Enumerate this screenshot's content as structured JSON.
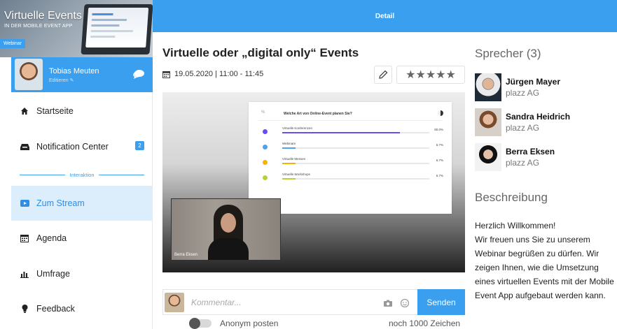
{
  "sidebar": {
    "banner": {
      "title": "Virtuelle Events",
      "subtitle": "IN DER MOBILE EVENT APP",
      "tag": "Webinar"
    },
    "profile": {
      "name": "Tobias Meuten",
      "edit_label": "Editieren"
    },
    "items": [
      {
        "label": "Startseite",
        "icon": "home-icon"
      },
      {
        "label": "Notification Center",
        "icon": "inbox-icon",
        "badge": "2"
      },
      {
        "label": "Zum Stream",
        "icon": "play-icon",
        "active": true
      },
      {
        "label": "Agenda",
        "icon": "calendar-icon"
      },
      {
        "label": "Umfrage",
        "icon": "bar-chart-icon"
      },
      {
        "label": "Feedback",
        "icon": "lightbulb-icon"
      }
    ],
    "section_label": "Interaktion"
  },
  "header": {
    "title": "Detail"
  },
  "event": {
    "title": "Virtuelle oder „digital only“ Events",
    "datetime": "19.05.2020 | 11:00 - 11:45",
    "rating_stars": "★★★★★"
  },
  "stream": {
    "slide": {
      "question": "Welche Art von Online-Event planen Sie?",
      "options": [
        {
          "label": "Virtuelle Konferenzen",
          "percent": "80.0%",
          "value": 0.8,
          "color": "#6a4cf0"
        },
        {
          "label": "Webinare",
          "percent": "6.7%",
          "value": 0.067,
          "color": "#4aa3f0"
        },
        {
          "label": "Virtuelle Messen",
          "percent": "6.7%",
          "value": 0.067,
          "color": "#f5b400"
        },
        {
          "label": "Virtuelle Workshops",
          "percent": "6.7%",
          "value": 0.067,
          "color": "#b5d334"
        }
      ]
    },
    "camera_label": "Berra Eksen"
  },
  "comment": {
    "placeholder": "Kommentar...",
    "send_label": "Senden",
    "anon_label": "Anonym posten",
    "char_count": "noch 1000 Zeichen"
  },
  "speakers": {
    "heading": "Sprecher",
    "count": "(3)",
    "list": [
      {
        "name": "Jürgen Mayer",
        "company": "plazz AG"
      },
      {
        "name": "Sandra Heidrich",
        "company": "plazz AG"
      },
      {
        "name": "Berra Eksen",
        "company": "plazz AG"
      }
    ]
  },
  "description": {
    "heading": "Beschreibung",
    "text": "Herzlich Willkommen!\nWir freuen uns Sie zu unserem Webinar begrüßen zu dürfen. Wir zeigen Ihnen, wie die Umsetzung eines virtuellen Events mit der Mobile Event App aufgebaut werden kann."
  },
  "colors": {
    "accent": "#3b9ff0",
    "active_bg": "#dcedfb"
  }
}
